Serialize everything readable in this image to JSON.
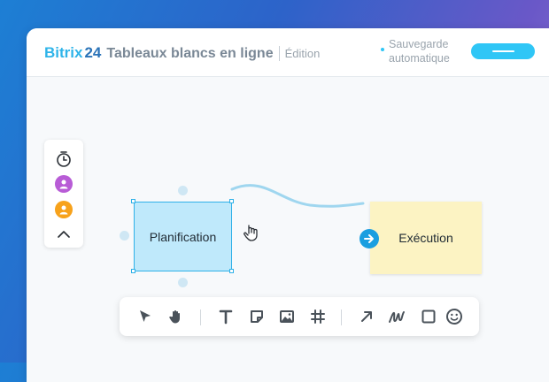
{
  "header": {
    "brand_bitrix": "Bitrix",
    "brand_number": "24",
    "app_title": "Tableaux blancs en ligne",
    "mode": "Édition",
    "autosave_label": "Sauvegarde automatique"
  },
  "side_panel": {
    "items": [
      "timer-icon",
      "user-avatar-purple",
      "user-avatar-orange",
      "chevron-up-icon"
    ]
  },
  "board": {
    "nodes": [
      {
        "label": "Planification",
        "color": "#bfe9fb",
        "selected": true
      },
      {
        "label": "Exécution",
        "color": "#fcf3c3",
        "selected": false
      }
    ]
  },
  "toolbar": {
    "tools": [
      "select-icon",
      "hand-icon",
      "text-icon",
      "sticky-note-icon",
      "image-icon",
      "grid-icon",
      "arrow-icon",
      "pen-icon",
      "shape-icon",
      "emoji-icon"
    ]
  },
  "colors": {
    "accent": "#2fc6f6",
    "brand_blue": "#2a73b8",
    "avatar_purple": "#b85cd6",
    "avatar_orange": "#f7a21b",
    "connector": "#9fd6ef"
  }
}
